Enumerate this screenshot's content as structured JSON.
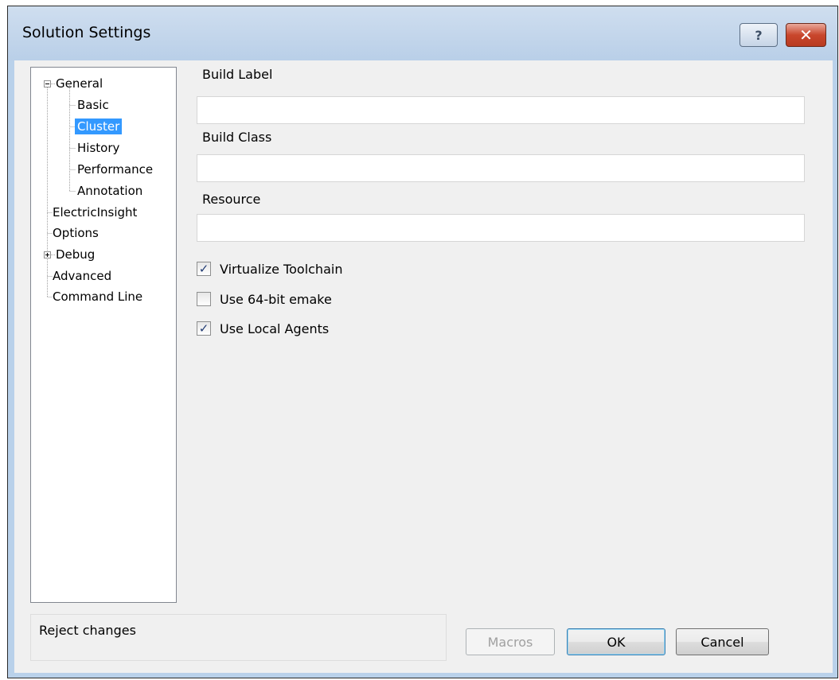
{
  "window": {
    "title": "Solution Settings",
    "help_glyph": "?",
    "close_glyph": "✕"
  },
  "tree": {
    "items": [
      {
        "label": "General",
        "expander": "minus"
      },
      {
        "label": "Basic"
      },
      {
        "label": "Cluster",
        "selected": true
      },
      {
        "label": "History"
      },
      {
        "label": "Performance"
      },
      {
        "label": "Annotation"
      },
      {
        "label": "ElectricInsight"
      },
      {
        "label": "Options"
      },
      {
        "label": "Debug",
        "expander": "plus"
      },
      {
        "label": "Advanced"
      },
      {
        "label": "Command Line"
      }
    ]
  },
  "form": {
    "build_label": {
      "label": "Build Label",
      "value": ""
    },
    "build_class": {
      "label": "Build Class",
      "value": ""
    },
    "resource": {
      "label": "Resource",
      "value": ""
    }
  },
  "checkboxes": [
    {
      "label": "Virtualize Toolchain",
      "checked": true
    },
    {
      "label": "Use 64-bit emake",
      "checked": false
    },
    {
      "label": "Use Local Agents",
      "checked": true
    }
  ],
  "status_text": "Reject changes",
  "buttons": {
    "macros": "Macros",
    "ok": "OK",
    "cancel": "Cancel"
  },
  "colors": {
    "selection": "#3399ff",
    "titlebar": "#b9d1ea",
    "close_button": "#c9462c"
  },
  "icons": {
    "help": "question-mark-icon",
    "close": "close-x-icon",
    "check": "checkmark-icon"
  }
}
